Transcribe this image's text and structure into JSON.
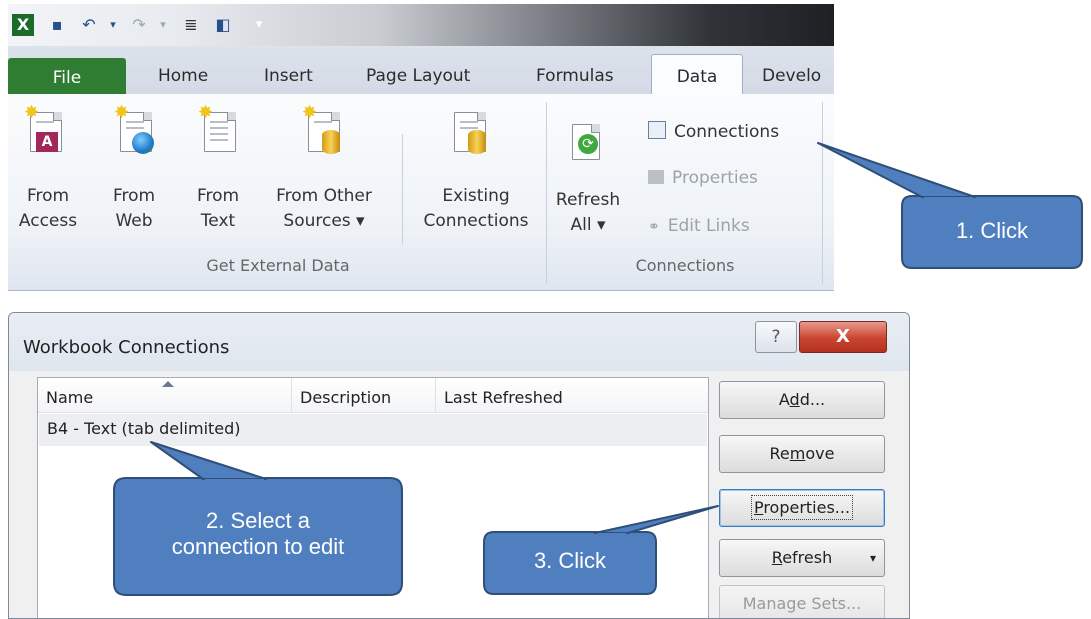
{
  "excel": {
    "tabs": [
      "File",
      "Home",
      "Insert",
      "Page Layout",
      "Formulas",
      "Data",
      "Develo"
    ],
    "get_external_data": {
      "buttons": [
        {
          "line1": "From",
          "line2": "Access"
        },
        {
          "line1": "From",
          "line2": "Web"
        },
        {
          "line1": "From",
          "line2": "Text"
        },
        {
          "line1": "From Other",
          "line2": "Sources ▾"
        },
        {
          "line1": "Existing",
          "line2": "Connections"
        }
      ],
      "group_label": "Get External Data"
    },
    "connections_group": {
      "refresh_line1": "Refresh",
      "refresh_line2": "All ▾",
      "connections": "Connections",
      "properties": "Properties",
      "edit_links": "Edit Links",
      "group_label": "Connections"
    }
  },
  "dialog": {
    "title": "Workbook Connections",
    "help_glyph": "?",
    "close_glyph": "X",
    "columns": [
      "Name",
      "Description",
      "Last Refreshed"
    ],
    "rows": [
      {
        "name": "B4 - Text (tab delimited)"
      }
    ],
    "buttons": {
      "add_pre": "A",
      "add_ul": "d",
      "add_post": "d...",
      "remove_pre": "Re",
      "remove_ul": "m",
      "remove_post": "ove",
      "properties_pre": "",
      "properties_ul": "P",
      "properties_post": "roperties...",
      "refresh_pre": "",
      "refresh_ul": "R",
      "refresh_post": "efresh",
      "refresh_arrow": "▾",
      "manage_sets": "Manage Sets..."
    }
  },
  "callouts": {
    "c1": "1. Click",
    "c2_line1": "2. Select a",
    "c2_line2": "connection to edit",
    "c3": "3. Click"
  },
  "colors": {
    "callout_fill": "#4f7fbf",
    "callout_stroke": "#2f4f78",
    "file_tab": "#2f7d32"
  }
}
